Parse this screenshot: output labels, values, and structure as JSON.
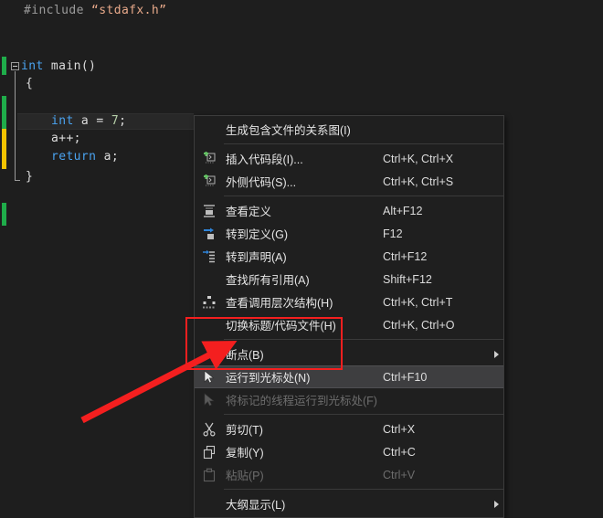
{
  "app": {
    "theme_name": "visual-studio-dark",
    "editor_background": "#1e1e1e",
    "menu_background": "#1f1f1f",
    "selection_background": "#3e3e40",
    "annotation_color": "#f41f1f"
  },
  "editor": {
    "code_lines": [
      {
        "indent": 0,
        "tokens": [
          {
            "text": "#include ",
            "kind": "pre"
          },
          {
            "text": "“stdafx.h”",
            "kind": "str"
          }
        ]
      },
      {
        "indent": 0,
        "tokens": [
          {
            "text": "int",
            "kind": "kw"
          },
          {
            "text": " main()",
            "kind": "plain"
          }
        ]
      },
      {
        "indent": 0,
        "tokens": [
          {
            "text": "{",
            "kind": "punct"
          }
        ]
      },
      {
        "indent": 0,
        "tokens": [
          {
            "text": "int",
            "kind": "kw"
          },
          {
            "text": " a = ",
            "kind": "plain"
          },
          {
            "text": "7",
            "kind": "num"
          },
          {
            "text": ";",
            "kind": "punct"
          }
        ]
      },
      {
        "indent": 0,
        "tokens": [
          {
            "text": "a++;",
            "kind": "plain"
          }
        ]
      },
      {
        "indent": 0,
        "tokens": [
          {
            "text": "return",
            "kind": "kw"
          },
          {
            "text": " a;",
            "kind": "plain"
          }
        ]
      },
      {
        "indent": 0,
        "tokens": [
          {
            "text": "}",
            "kind": "punct"
          }
        ]
      }
    ],
    "change_bars": [
      {
        "state": "added"
      },
      {
        "state": "added"
      },
      {
        "state": "changed"
      },
      {
        "state": "added"
      }
    ]
  },
  "context_menu": {
    "items": [
      {
        "label": "生成包含文件的关系图(I)",
        "shortcut": "",
        "icon": "",
        "disabled": false,
        "selected": false,
        "submenu": false
      },
      {
        "separator": true
      },
      {
        "label": "插入代码段(I)...",
        "shortcut": "Ctrl+K, Ctrl+X",
        "icon": "insert-snippet-icon",
        "disabled": false,
        "selected": false,
        "submenu": false
      },
      {
        "label": "外侧代码(S)...",
        "shortcut": "Ctrl+K, Ctrl+S",
        "icon": "surround-with-icon",
        "disabled": false,
        "selected": false,
        "submenu": false
      },
      {
        "separator": true
      },
      {
        "label": "查看定义",
        "shortcut": "Alt+F12",
        "icon": "peek-definition-icon",
        "disabled": false,
        "selected": false,
        "submenu": false
      },
      {
        "label": "转到定义(G)",
        "shortcut": "F12",
        "icon": "go-to-definition-icon",
        "disabled": false,
        "selected": false,
        "submenu": false
      },
      {
        "label": "转到声明(A)",
        "shortcut": "Ctrl+F12",
        "icon": "go-to-declaration-icon",
        "disabled": false,
        "selected": false,
        "submenu": false
      },
      {
        "label": "查找所有引用(A)",
        "shortcut": "Shift+F12",
        "icon": "",
        "disabled": false,
        "selected": false,
        "submenu": false
      },
      {
        "label": "查看调用层次结构(H)",
        "shortcut": "Ctrl+K, Ctrl+T",
        "icon": "call-hierarchy-icon",
        "disabled": false,
        "selected": false,
        "submenu": false
      },
      {
        "label": "切换标题/代码文件(H)",
        "shortcut": "Ctrl+K, Ctrl+O",
        "icon": "",
        "disabled": false,
        "selected": false,
        "submenu": false
      },
      {
        "separator": true
      },
      {
        "label": "断点(B)",
        "shortcut": "",
        "icon": "",
        "disabled": false,
        "selected": false,
        "submenu": true
      },
      {
        "label": "运行到光标处(N)",
        "shortcut": "Ctrl+F10",
        "icon": "run-to-cursor-icon",
        "disabled": false,
        "selected": true,
        "submenu": false
      },
      {
        "label": "将标记的线程运行到光标处(F)",
        "shortcut": "",
        "icon": "run-flagged-threads-to-cursor-icon",
        "disabled": true,
        "selected": false,
        "submenu": false
      },
      {
        "separator": true
      },
      {
        "label": "剪切(T)",
        "shortcut": "Ctrl+X",
        "icon": "cut-icon",
        "disabled": false,
        "selected": false,
        "submenu": false
      },
      {
        "label": "复制(Y)",
        "shortcut": "Ctrl+C",
        "icon": "copy-icon",
        "disabled": false,
        "selected": false,
        "submenu": false
      },
      {
        "label": "粘贴(P)",
        "shortcut": "Ctrl+V",
        "icon": "paste-icon",
        "disabled": true,
        "selected": false,
        "submenu": false
      },
      {
        "separator": true
      },
      {
        "label": "大纲显示(L)",
        "shortcut": "",
        "icon": "",
        "disabled": false,
        "selected": false,
        "submenu": true
      }
    ]
  }
}
